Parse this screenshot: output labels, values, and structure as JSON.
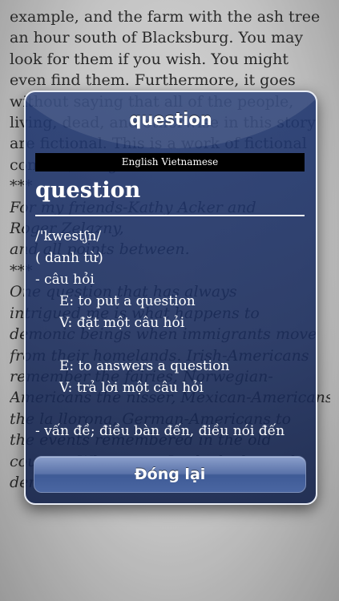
{
  "book": {
    "lines": [
      {
        "text": "example, and the farm with the ash tree",
        "italic": false
      },
      {
        "text": "an hour south of Blacksburg. You may",
        "italic": false
      },
      {
        "text": "look for them if you wish. You might",
        "italic": false
      },
      {
        "text": "even find them. Furthermore, it goes",
        "italic": false
      },
      {
        "text": "without saying that all of the people,",
        "italic": false
      },
      {
        "text": "living, dead, and otherwise in this story",
        "italic": false
      },
      {
        "text": "are fictional. This is a work of fictional",
        "italic": false
      },
      {
        "text": "content, the gods are real.",
        "italic": false
      },
      {
        "text": "***",
        "italic": false
      },
      {
        "text": "For my friends-Kathy Acker and",
        "italic": true
      },
      {
        "text": "Roger Zelazny,",
        "italic": true
      },
      {
        "text": "and all points between.",
        "italic": true
      },
      {
        "text": "***",
        "italic": false
      },
      {
        "text": "One question that has always",
        "italic": true
      },
      {
        "text": "intrigued me is what happens to",
        "italic": true
      },
      {
        "text": "demonic beings when immigrants move",
        "italic": true
      },
      {
        "text": "from their homelands. Irish-Americans",
        "italic": true
      },
      {
        "text": "remember the fairies, Norwegian-",
        "italic": true
      },
      {
        "text": "Americans the nisser, Mexican-Americans",
        "italic": true
      },
      {
        "text": "the la llorona, German-Americans to",
        "italic": true
      },
      {
        "text": "the events remembered in the old",
        "italic": true
      },
      {
        "text": "country. When once I asked why such",
        "italic": true
      },
      {
        "text": "demons are not seen in America, my",
        "italic": true
      }
    ]
  },
  "dialog": {
    "title": "question",
    "dictionary_name": "English Vietnamese",
    "headword": "question",
    "lines": [
      {
        "text": "/'kwestʃn/",
        "indent": false
      },
      {
        "text": "( danh từ)",
        "indent": false
      },
      {
        "text": "- câu hỏi",
        "indent": false
      },
      {
        "text": "E: to put a question",
        "indent": true
      },
      {
        "text": "V: đặt một câu hỏi",
        "indent": true
      },
      {
        "text": "",
        "indent": false
      },
      {
        "text": "E: to answers a question",
        "indent": true
      },
      {
        "text": "V: trả lời một câu hỏi",
        "indent": true
      },
      {
        "text": "",
        "indent": false
      },
      {
        "text": "- vấn đề; điều bàn đến, điều nói đến",
        "indent": false
      }
    ],
    "close_label": "Đóng lại"
  }
}
